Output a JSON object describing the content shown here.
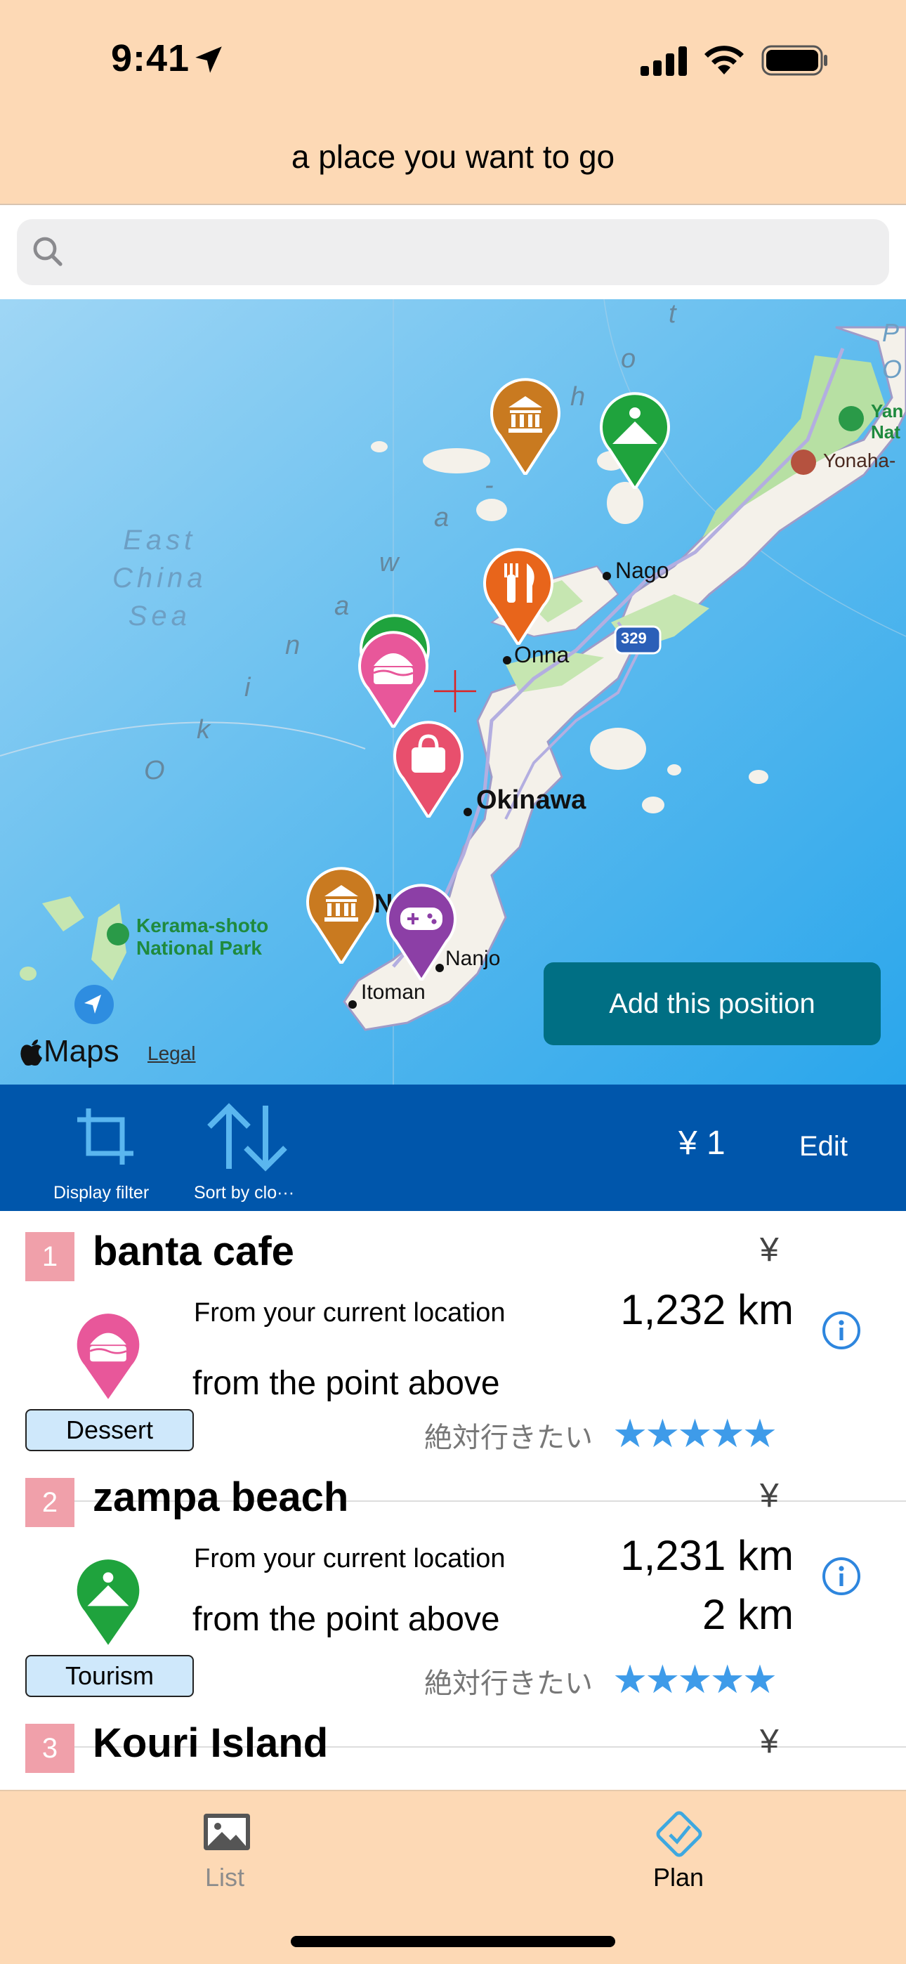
{
  "status_bar": {
    "time": "9:41"
  },
  "nav": {
    "title": "a place you want to go"
  },
  "search": {
    "placeholder": ""
  },
  "map": {
    "sea_label": "East\nChina\nSea",
    "arc_letters": [
      "O",
      "k",
      "i",
      "n",
      "a",
      "w",
      "a",
      "-",
      "s",
      "h",
      "o",
      "t"
    ],
    "places": {
      "nago": "Nago",
      "onna": "Onna",
      "okinawa": "Okinawa",
      "nanjo": "Nanjo",
      "itoman": "Itoman",
      "naha_partial": "N",
      "kerama": "Kerama-shoto\nNational Park",
      "yonaha": "Yonaha-",
      "yanbaru_partial": "Yan\nNat",
      "route": "329",
      "edge_partial": "P\nO"
    },
    "attribution": {
      "logo": "Maps",
      "legal": "Legal"
    },
    "add_button": "Add this position"
  },
  "toolbar": {
    "filter_label": "Display filter",
    "sort_label": "Sort by clo···",
    "total": "¥ 1",
    "edit": "Edit"
  },
  "list": [
    {
      "number": "1",
      "name": "banta cafe",
      "yen": "¥",
      "from_current_label": "From your current location",
      "from_current_value": "1,232 km",
      "from_prev_label": "from the point above",
      "from_prev_value": "",
      "category": "Dessert",
      "category_color": "#e8579a",
      "rating_label": "絶対行きたい",
      "rating": 5,
      "stars": "★★★★★"
    },
    {
      "number": "2",
      "name": "zampa beach",
      "yen": "¥",
      "from_current_label": "From your current location",
      "from_current_value": "1,231 km",
      "from_prev_label": "from the point above",
      "from_prev_value": "2 km",
      "category": "Tourism",
      "category_color": "#1fa33d",
      "rating_label": "絶対行きたい",
      "rating": 5,
      "stars": "★★★★★"
    },
    {
      "number": "3",
      "name": "Kouri Island",
      "yen": "¥"
    }
  ],
  "tabbar": {
    "list": "List",
    "plan": "Plan"
  },
  "colors": {
    "header_bg": "#fdd9b5",
    "toolbar_bg": "#0056ab",
    "add_button_bg": "#006f84",
    "badge_bg": "#f0a0aa",
    "star": "#3e9be9",
    "plan_accent": "#3ea8e0"
  }
}
